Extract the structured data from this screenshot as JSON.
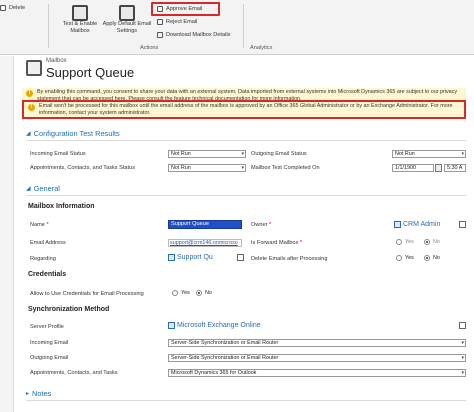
{
  "ribbon": {
    "delete_label": "Delete",
    "test_enable_label": [
      "Test & Enable",
      "Mailbox"
    ],
    "apply_default_label": [
      "Apply Default Email",
      "Settings"
    ],
    "approve_email_label": "Approve Email",
    "reject_email_label": "Reject Email",
    "download_details_label": "Download Mailbox Details",
    "group_actions": "Actions",
    "group_analytics": "Analytics"
  },
  "header": {
    "entity": "Mailbox",
    "title": "Support Queue"
  },
  "alerts": {
    "consent": "By enabling this command, you consent to share your data with an external system. Data imported from external systems into Microsoft Dynamics 365 are subject to our privacy statement that can be accessed here. Please consult the feature technical documentation for more information.",
    "approval": "Email won't be processed for this mailbox until the email address of the mailbox is approved by an Office 365 Global Administrator or by an Exchange Administrator. For more information, contact your system administrator."
  },
  "config_section": {
    "title": "Configuration Test Results",
    "incoming_label": "Incoming Email Status",
    "incoming_value": "Not Run",
    "outgoing_label": "Outgoing Email Status",
    "outgoing_value": "Not Run",
    "appointments_label": "Appointments, Contacts, and Tasks Status",
    "appointments_value": "Not Run",
    "completed_label": "Mailbox Test Completed On",
    "completed_date": "1/1/1900",
    "completed_time": "5:30 A"
  },
  "general": {
    "title": "General",
    "mailbox_info": "Mailbox Information",
    "name_label": "Name",
    "name_value": "Support Queue",
    "owner_label": "Owner",
    "owner_value": "CRM Admin",
    "email_label": "Email Address",
    "email_value": "support@crm146.onmicroso",
    "forward_label": "Is Forward Mailbox",
    "yes": "Yes",
    "no": "No",
    "regarding_label": "Regarding",
    "regarding_value": "Support Qu",
    "delete_label": "Delete Emails after Processing",
    "credentials": "Credentials",
    "allow_cred_label": "Allow to Use Credentials for Email Processing",
    "sync_method": "Synchronization Method",
    "server_profile_label": "Server Profile",
    "server_profile_value": "Microsoft Exchange Online",
    "incoming_label": "Incoming Email",
    "incoming_value": "Server-Side Synchronization or Email Router",
    "outgoing_label": "Outgoing Email",
    "outgoing_value": "Server-Side Synchronization or Email Router",
    "appointments_label": "Appointments, Contacts, and Tasks",
    "appointments_value": "Microsoft Dynamics 365 for Outlook"
  },
  "notes": {
    "title": "Notes"
  },
  "colors": {
    "accent": "#1e6fb5",
    "highlight": "#d42a2a",
    "warning": "#fff7d1"
  }
}
